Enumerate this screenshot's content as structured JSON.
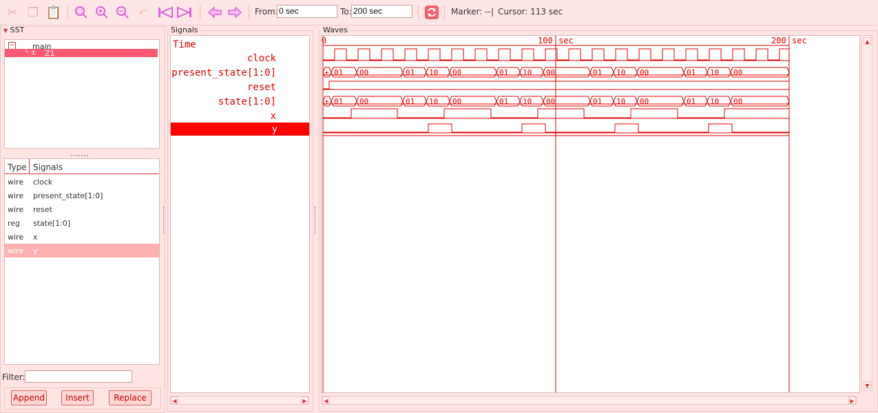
{
  "toolbar": {
    "from_label": "From:",
    "from_value": "0 sec",
    "to_label": "To:",
    "to_value": "200 sec",
    "marker_text": "Marker: --",
    "sep_char": "|",
    "cursor_text": "Cursor: 113 sec"
  },
  "sst": {
    "title": "SST",
    "tree": {
      "root": "main",
      "child": "Z1"
    },
    "columns": {
      "type": "Type",
      "signals": "Signals"
    },
    "rows": [
      {
        "type": "wire",
        "name": "clock"
      },
      {
        "type": "wire",
        "name": "present_state[1:0]"
      },
      {
        "type": "wire",
        "name": "reset"
      },
      {
        "type": "reg",
        "name": "state[1:0]"
      },
      {
        "type": "wire",
        "name": "x"
      },
      {
        "type": "wire",
        "name": "y"
      }
    ],
    "filter_label": "Filter:",
    "filter_value": "",
    "buttons": {
      "append": "Append",
      "insert": "Insert",
      "replace": "Replace"
    }
  },
  "signals_panel": {
    "title": "Signals",
    "time_label": "Time",
    "names": [
      "clock",
      "present_state[1:0]",
      "reset",
      "state[1:0]",
      "x",
      "y"
    ],
    "selected": "y"
  },
  "waves_panel": {
    "title": "Waves",
    "ruler": {
      "start": "0",
      "mid": "100",
      "mid_unit": "sec",
      "end": "200",
      "end_unit": "sec"
    },
    "state_values": {
      "first": "+",
      "sequence": [
        "01",
        "00",
        "01",
        "10",
        "00",
        "01",
        "10",
        "00",
        "01",
        "10",
        "00",
        "01",
        "10",
        "00"
      ]
    }
  },
  "colors": {
    "accent": "#e00000",
    "wave": "#e00000",
    "selected_row": "#ff0000",
    "background": "#ffe4e4"
  }
}
